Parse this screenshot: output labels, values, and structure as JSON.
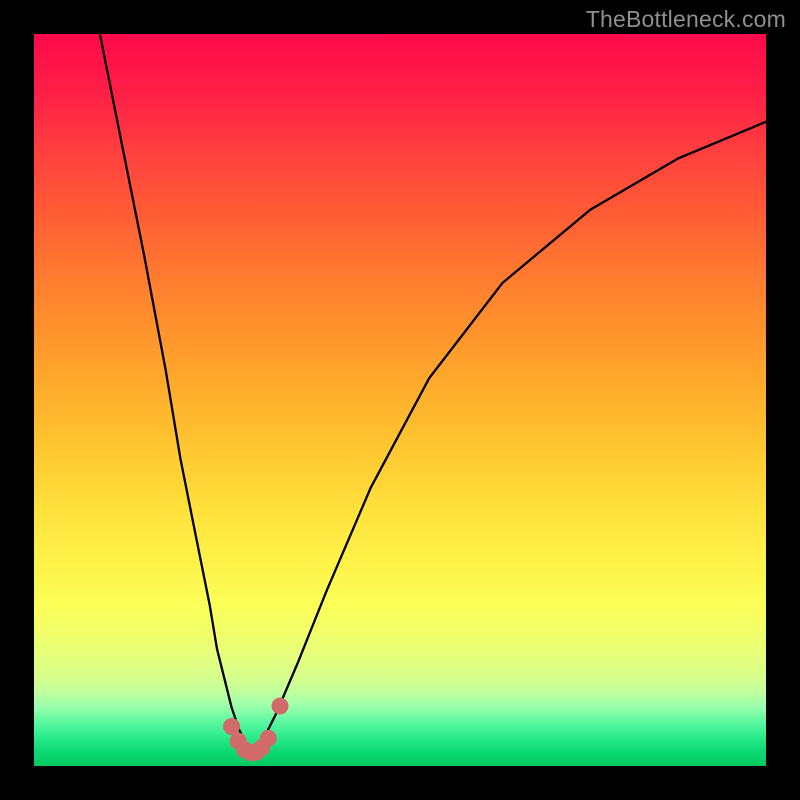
{
  "watermark": "TheBottleneck.com",
  "palette": {
    "frame": "#000000",
    "curve_stroke": "#000000",
    "marker_fill": "#d16a6a",
    "marker_stroke": "#d16a6a",
    "gradient_top": "#ff0a4a",
    "gradient_bottom": "#05c95f"
  },
  "chart_data": {
    "type": "line",
    "title": "",
    "xlabel": "",
    "ylabel": "",
    "xlim": [
      0,
      100
    ],
    "ylim": [
      0,
      100
    ],
    "series": [
      {
        "name": "left-branch",
        "x": [
          9,
          12,
          15,
          18,
          20,
          22,
          24,
          25,
          26,
          27,
          28,
          29
        ],
        "y": [
          100,
          85,
          70,
          54,
          42,
          32,
          22,
          16,
          12,
          8,
          5,
          3
        ]
      },
      {
        "name": "right-branch",
        "x": [
          31,
          33,
          36,
          40,
          46,
          54,
          64,
          76,
          88,
          100
        ],
        "y": [
          3,
          7,
          14,
          24,
          38,
          53,
          66,
          76,
          83,
          88
        ]
      }
    ],
    "markers": {
      "name": "bottom-dots",
      "x": [
        27.0,
        27.9,
        28.8,
        29.7,
        30.4,
        31.1,
        32.0,
        33.6
      ],
      "y": [
        5.4,
        3.4,
        2.2,
        1.8,
        1.9,
        2.5,
        3.8,
        8.2
      ]
    }
  }
}
